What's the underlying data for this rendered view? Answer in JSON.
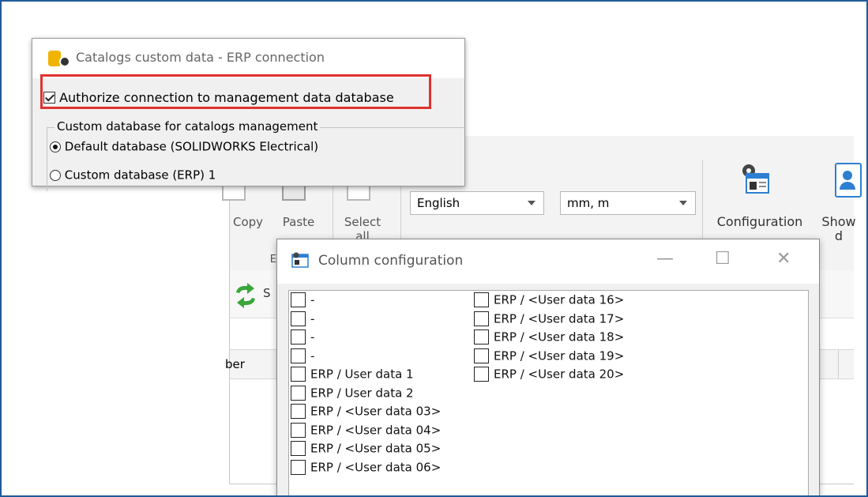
{
  "ribbon": {
    "copy_label": "Copy",
    "paste_label": "Paste",
    "select_all_label": "Select all",
    "edit_group_label": "Ed",
    "language_value": "English",
    "units_value": "mm, m",
    "configuration_label": "Configuration",
    "show_label": "Show d"
  },
  "toolbar": {
    "sync_label": "S"
  },
  "grid": {
    "first_header": "ber"
  },
  "catalogs_dialog": {
    "title": "Catalogs custom data - ERP connection",
    "authorize_label": "Authorize connection to management data database",
    "authorize_checked": true,
    "group_label": "Custom database for catalogs management",
    "option_default": "Default database (SOLIDWORKS Electrical)",
    "option_custom": "Custom database (ERP) 1",
    "selected_option": "default"
  },
  "column_dialog": {
    "title": "Column configuration",
    "minimize": "—",
    "maximize": "☐",
    "close": "✕",
    "left_column": [
      "-",
      "-",
      "-",
      "-",
      "ERP / User data 1",
      "ERP / User data 2",
      "ERP / <User data 03>",
      "ERP / <User data 04>",
      "ERP / <User data 05>",
      "ERP / <User data 06>"
    ],
    "right_column": [
      "ERP / <User data 16>",
      "ERP / <User data 17>",
      "ERP / <User data 18>",
      "ERP / <User data 19>",
      "ERP / <User data 20>"
    ]
  },
  "colors": {
    "frame_border": "#1f5b99",
    "highlight": "#e0322f",
    "sync_icon": "#3aa63a"
  }
}
